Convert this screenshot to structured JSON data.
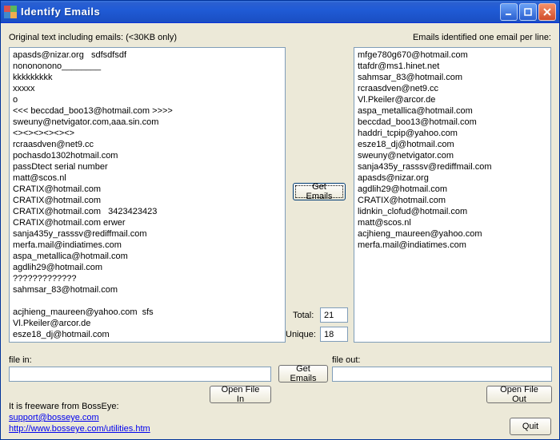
{
  "window": {
    "title": "Identify Emails"
  },
  "left_label": "Original text including emails: (<30KB only)",
  "right_label": "Emails identified one email per line:",
  "left_text": "apasds@nizar.org   sdfsdfsdf\nnonononono________\nkkkkkkkkk\nxxxxx\no\n<<< beccdad_boo13@hotmail.com >>>>\nsweuny@netvigator.com,aaa.sin.com\n<><><><><><>\nrcraasdven@net9.cc\npochasdo1302hotmail.com\npassDtect serial number\nmatt@scos.nl\nCRATIX@hotmail.com\nCRATIX@hotmail.com\nCRATIX@hotmail.com   3423423423\nCRATIX@hotmail.com erwer\nsanja435y_rasssv@rediffmail.com\nmerfa.mail@indiatimes.com\naspa_metallica@hotmail.com\nagdlih29@hotmail.com\n?????????????\nsahmsar_83@hotmail.com\n\nacjhieng_maureen@yahoo.com  sfs\nVl.Pkeiler@arcor.de\nesze18_dj@hotmail.com",
  "right_text": "mfge780g670@hotmail.com\nttafdr@ms1.hinet.net\nsahmsar_83@hotmail.com\nrcraasdven@net9.cc\nVl.Pkeiler@arcor.de\naspa_metallica@hotmail.com\nbeccdad_boo13@hotmail.com\nhaddri_tcpip@yahoo.com\nesze18_dj@hotmail.com\nsweuny@netvigator.com\nsanja435y_rasssv@rediffmail.com\napasds@nizar.org\nagdlih29@hotmail.com\nCRATIX@hotmail.com\nlidnkin_clofud@hotmail.com\nmatt@scos.nl\nacjhieng_maureen@yahoo.com\nmerfa.mail@indiatimes.com",
  "buttons": {
    "get_emails_center": "Get Emails",
    "get_emails_lower": "Get Emails",
    "open_file_in": "Open File In",
    "open_file_out": "Open File Out",
    "quit": "Quit"
  },
  "counters": {
    "total_label": "Total:",
    "total_value": "21",
    "unique_label": "Unique:",
    "unique_value": "18"
  },
  "file_in_label": "file in:",
  "file_out_label": "file out:",
  "file_in_value": "",
  "file_out_value": "",
  "footer": {
    "freeware": "It is freeware from BossEye:",
    "support": "support@bosseye.com",
    "url": "http://www.bosseye.com/utilities.htm"
  }
}
